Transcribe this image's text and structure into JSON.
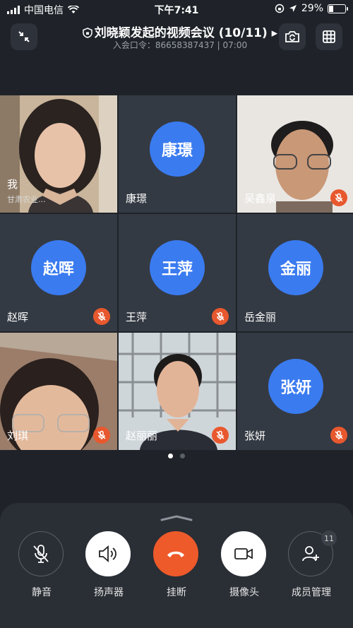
{
  "status_bar": {
    "carrier": "中国电信",
    "time": "下午7:41",
    "battery": "29%"
  },
  "header": {
    "title": "刘晓颖发起的视频会议 (10/11) ▸",
    "subtitle": "入会口令：86658387437 | 07:00"
  },
  "tiles": [
    {
      "name": "我",
      "subname": "甘肃农业...",
      "video": true
    },
    {
      "name": "康璟",
      "avatar": "康璟",
      "muted": false
    },
    {
      "name": "吴鑫泉",
      "video": true,
      "muted": true
    },
    {
      "name": "赵晖",
      "avatar": "赵晖",
      "muted": true
    },
    {
      "name": "王萍",
      "avatar": "王萍",
      "muted": true
    },
    {
      "name": "岳金丽",
      "avatar": "金丽",
      "muted": false
    },
    {
      "name": "刘琪",
      "video": true,
      "muted": true
    },
    {
      "name": "赵丽丽",
      "video": true,
      "muted": true
    },
    {
      "name": "张妍",
      "avatar": "张妍",
      "muted": true
    }
  ],
  "pager": {
    "pages": 2,
    "current": 1
  },
  "controls": {
    "mute": "静音",
    "speaker": "扬声器",
    "hangup": "挂断",
    "camera": "摄像头",
    "members": "成员管理",
    "members_count": "11"
  },
  "colors": {
    "avatar": "#3a7bf0",
    "mute_badge": "#e8582e",
    "hangup": "#ee5a2a",
    "background": "#1f2329"
  }
}
